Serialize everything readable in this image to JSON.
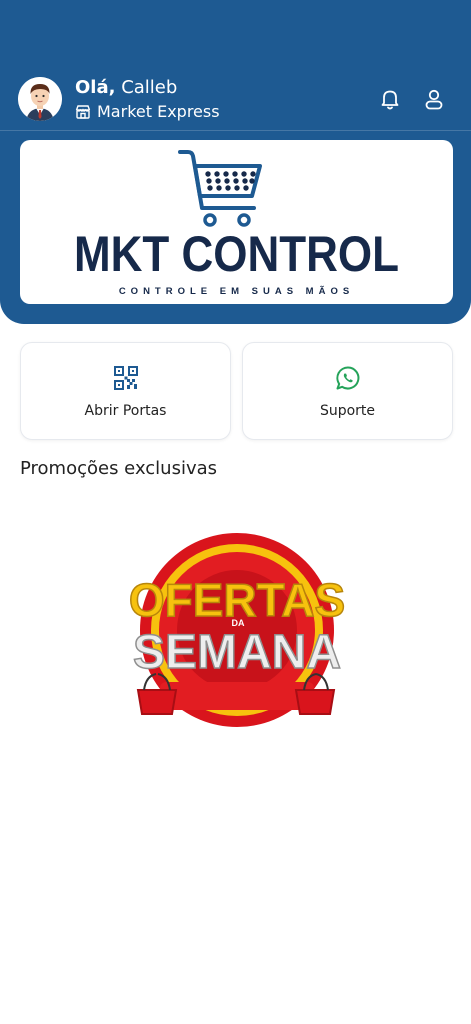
{
  "header": {
    "greeting_prefix": "Olá,",
    "user_name": "Calleb",
    "store_name": "Market Express"
  },
  "brand": {
    "logo_title": "MKT CONTROL",
    "logo_subtitle": "CONTROLE EM SUAS MÃOS"
  },
  "actions": [
    {
      "label": "Abrir Portas",
      "icon": "qr-code-icon"
    },
    {
      "label": "Suporte",
      "icon": "whatsapp-icon"
    }
  ],
  "promotions": {
    "title": "Promoções exclusivas",
    "banner_text_top": "OFERTAS",
    "banner_text_small": "DA",
    "banner_text_bottom": "SEMANA"
  },
  "colors": {
    "header_bg": "#1e5a92",
    "logo_navy": "#16294a",
    "whatsapp_green": "#25a35a",
    "promo_red": "#d9141c",
    "promo_yellow": "#f7c20e"
  }
}
